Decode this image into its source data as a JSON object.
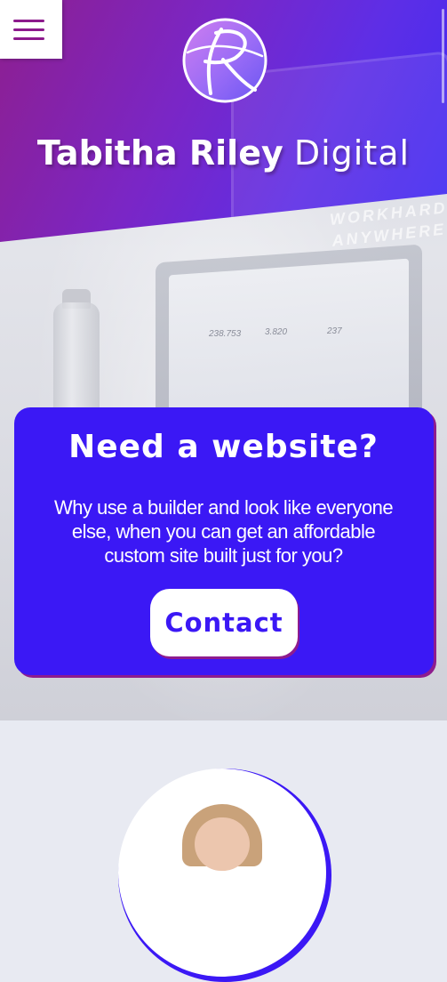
{
  "brand": {
    "name_bold": "Tabitha Riley",
    "name_light": "Digital",
    "logo_letter": "R"
  },
  "menu": {
    "icon": "hamburger-menu-icon"
  },
  "hero_photo": {
    "wall_text_line1": "WORKHARD",
    "wall_text_line2": "ANYWHERE",
    "stats": [
      "238.753",
      "3.820",
      "237"
    ]
  },
  "cta": {
    "title": "Need a website?",
    "text": "Why use a builder and look like everyone else, when you can get an affordable custom site built just for you?",
    "button_label": "Contact"
  },
  "colors": {
    "accent": "#3b18f5",
    "brand_purple": "#8e1c8e",
    "banner_start": "#8e1f8f",
    "banner_end": "#3f2bf3"
  }
}
